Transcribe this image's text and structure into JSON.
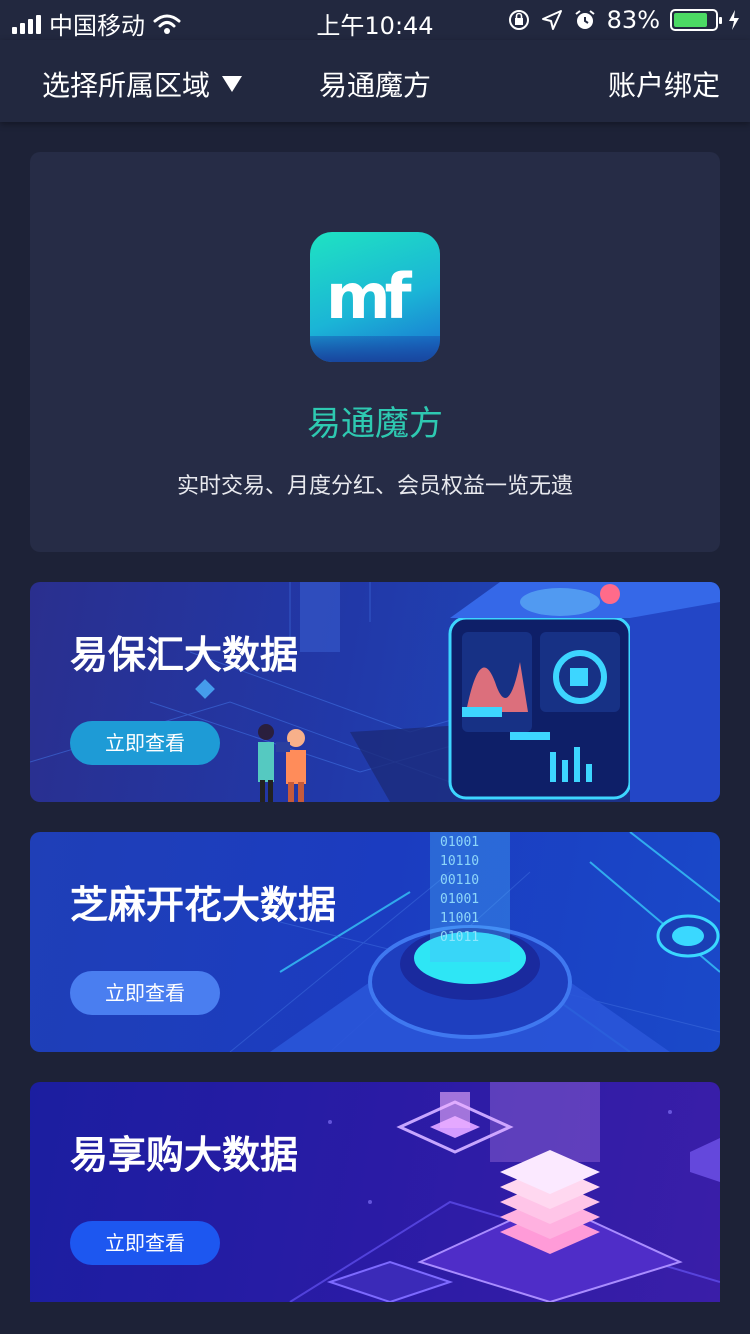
{
  "status_bar": {
    "carrier": "中国移动",
    "time": "上午10:44",
    "battery": "83%",
    "battery_level": 0.83
  },
  "nav": {
    "region_label": "选择所属区域",
    "title": "易通魔方",
    "account_bind": "账户绑定"
  },
  "intro": {
    "title": "易通魔方",
    "subtitle": "实时交易、月度分红、会员权益一览无遗"
  },
  "banners": [
    {
      "title": "易保汇大数据",
      "button": "立即查看"
    },
    {
      "title": "芝麻开花大数据",
      "button": "立即查看"
    },
    {
      "title": "易享购大数据",
      "button": "立即查看"
    }
  ],
  "decor_binary": [
    "01001",
    "10110",
    "00110",
    "01001",
    "11001",
    "01011"
  ],
  "colors": {
    "background": "#1d2237",
    "accent_teal": "#2ec9b1",
    "battery_green": "#4cd964"
  }
}
